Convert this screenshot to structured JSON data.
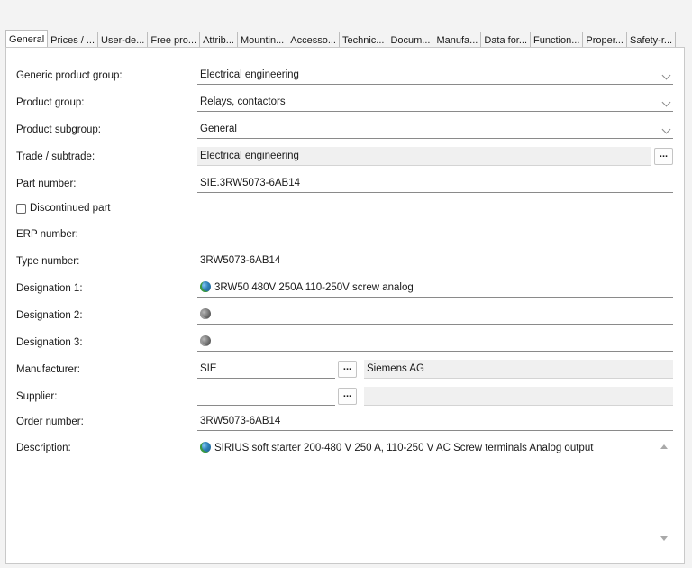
{
  "tabs": [
    {
      "label": "General",
      "active": true
    },
    {
      "label": "Prices / ..."
    },
    {
      "label": "User-de..."
    },
    {
      "label": "Free pro..."
    },
    {
      "label": "Attrib..."
    },
    {
      "label": "Mountin..."
    },
    {
      "label": "Accesso..."
    },
    {
      "label": "Technic..."
    },
    {
      "label": "Docum..."
    },
    {
      "label": "Manufa..."
    },
    {
      "label": "Data for..."
    },
    {
      "label": "Function..."
    },
    {
      "label": "Proper..."
    },
    {
      "label": "Safety-r..."
    }
  ],
  "form": {
    "generic_product_group": {
      "label": "Generic product group:",
      "value": "Electrical engineering"
    },
    "product_group": {
      "label": "Product group:",
      "value": "Relays, contactors"
    },
    "product_subgroup": {
      "label": "Product subgroup:",
      "value": "General"
    },
    "trade_subtrade": {
      "label": "Trade / subtrade:",
      "value": "Electrical engineering",
      "button": "..."
    },
    "part_number": {
      "label": "Part number:",
      "value": "SIE.3RW5073-6AB14"
    },
    "discontinued": {
      "label": "Discontinued part",
      "checked": false
    },
    "erp_number": {
      "label": "ERP number:",
      "value": ""
    },
    "type_number": {
      "label": "Type number:",
      "value": "3RW5073-6AB14"
    },
    "designation_1": {
      "label": "Designation 1:",
      "value": "3RW50 480V 250A 110-250V screw analog"
    },
    "designation_2": {
      "label": "Designation 2:",
      "value": ""
    },
    "designation_3": {
      "label": "Designation 3:",
      "value": ""
    },
    "manufacturer": {
      "label": "Manufacturer:",
      "value": "SIE",
      "button": "...",
      "name": "Siemens AG"
    },
    "supplier": {
      "label": "Supplier:",
      "value": "",
      "button": "...",
      "name": ""
    },
    "order_number": {
      "label": "Order number:",
      "value": "3RW5073-6AB14"
    },
    "description": {
      "label": "Description:",
      "value": "SIRIUS soft starter 200-480 V 250 A, 110-250 V AC Screw terminals Analog output"
    }
  }
}
